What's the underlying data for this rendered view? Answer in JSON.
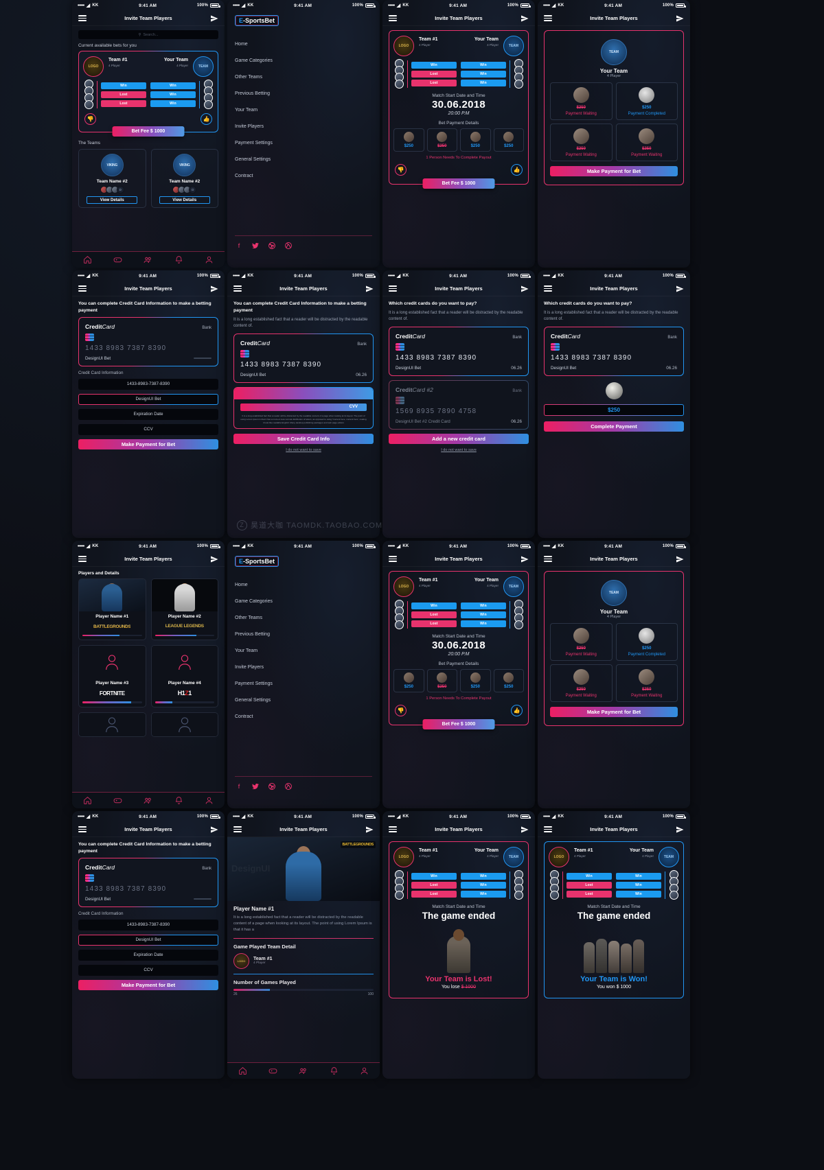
{
  "status_bar": {
    "carrier": "KK",
    "dots": "•••••",
    "time": "9:41 AM",
    "battery": "100%"
  },
  "nav": {
    "title": "Invite Team Players"
  },
  "search": {
    "placeholder": "Search...",
    "icon": "search-icon"
  },
  "brand": {
    "logo_prefix": "E",
    "logo_rest": "-SportsBet"
  },
  "drawer": {
    "items": [
      "Home",
      "Game Categories",
      "Other Teams",
      "Previous Betting",
      "Your Team",
      "Invite Players",
      "Payment Settings",
      "General Settings",
      "Contract"
    ],
    "social": [
      "facebook-icon",
      "twitter-icon",
      "dribbble-icon",
      "xbox-icon"
    ]
  },
  "tabbar": {
    "items": [
      "home-icon",
      "controller-icon",
      "team-icon",
      "bell-icon",
      "user-icon"
    ]
  },
  "home": {
    "section_bets": "Current available bets for you",
    "section_teams": "The Teams",
    "bet": {
      "left_team": "Team #1",
      "left_sub": "4 Player",
      "right_team": "Your Team",
      "right_sub": "4 Player",
      "scores_left": [
        "Win",
        "Lost",
        "Lost"
      ],
      "scores_right": [
        "Win",
        "Win",
        "Win"
      ],
      "fee_label": "Bet Fee $ 1000",
      "thumb_down": "thumb-down-icon",
      "thumb_up": "thumb-up-icon"
    },
    "teams": [
      {
        "name": "Team Name #2",
        "more": "D",
        "view": "View Details"
      },
      {
        "name": "Team Name #2",
        "more": "D",
        "view": "View Details"
      }
    ]
  },
  "match": {
    "date_label": "Match Start Date and Time",
    "date": "30.06.2018",
    "time": "20:00 P.M",
    "payment_label": "Bet Payment Details",
    "payments": [
      {
        "amount": "$250",
        "paid": true
      },
      {
        "amount": "$250",
        "paid": false
      },
      {
        "amount": "$250",
        "paid": true
      },
      {
        "amount": "$250",
        "paid": true
      }
    ],
    "need_payout": "1 Person Needs To Complete Payout",
    "fee_label": "Bet Fee $ 1000",
    "ended_label": "The game ended"
  },
  "team_payment": {
    "team_name": "Your Team",
    "team_sub": "4 Player",
    "cells": [
      {
        "amount": "$250",
        "status": "Payment Waiting",
        "state": "wait"
      },
      {
        "amount": "$250",
        "status": "Payment Completed",
        "state": "done"
      },
      {
        "amount": "$250",
        "status": "Payment Waiting",
        "state": "wait"
      },
      {
        "amount": "$250",
        "status": "Payment Waiting",
        "state": "wait"
      }
    ],
    "cta": "Make Payment for Bet"
  },
  "credit_card": {
    "heading": "You can complete Credit Card Information to make a betting payment",
    "subtext": "It is a long established fact that a reader will be distracted by the readable content of.",
    "card": {
      "brand_bold": "Credit",
      "brand_italic": "Card",
      "bank": "Bank",
      "number": "1433  8983  7387  8390",
      "holder": "DesignUI Bet",
      "expiry": "06.26"
    },
    "card2": {
      "brand_bold": "Credit",
      "brand_italic": "Card #2",
      "bank": "Bank",
      "number": "1569  8935  7890  4758",
      "holder": "DesignUI Bet #2 Credit Card",
      "expiry": "06.26"
    },
    "info_label": "Credit Card Information",
    "fields": {
      "number": "1433-8983-7387-8390",
      "name": "DesignUI Bet",
      "expiry": "Expiration Date",
      "ccv": "CCV"
    },
    "cvv_label": "CVV",
    "fine_print": "It is a long established fact that a reader will be distracted by the readable content of a page when looking at its layout. The point of using Lorem Ipsum is that it has a more-or-less normal distribution of letters, as opposed to using 'Content here, content here', making it look like readable English. Many desktop publishing packages and web page editors",
    "cta_pay": "Make Payment for Bet",
    "cta_save": "Save Credit Card Info",
    "cta_add": "Add a new credit card",
    "cta_complete": "Complete Payment",
    "do_not_save": "I do not want to save",
    "question": "Which credit cards do you want to pay?",
    "amount": "$250"
  },
  "players": {
    "section": "Players and Details",
    "list": [
      {
        "name": "Player Name #1",
        "game": "BATTLEGROUNDS",
        "game_key": "pubg",
        "progress": 62
      },
      {
        "name": "Player Name #2",
        "game": "LEAGUE LEGENDS",
        "game_key": "lol",
        "progress": 70
      },
      {
        "name": "Player Name #3",
        "game": "FORTNITE",
        "game_key": "fortnite",
        "progress": 82
      },
      {
        "name": "Player Name #4",
        "game": "H1Z1",
        "game_key": "h1z1",
        "progress": 30
      },
      {
        "name": "",
        "game": "",
        "game_key": "empty",
        "progress": 0
      },
      {
        "name": "",
        "game": "",
        "game_key": "empty",
        "progress": 0
      }
    ]
  },
  "player_detail": {
    "badge": "BATTLEGROUNDS",
    "name": "Player Name #1",
    "desc": "It is a long established fact that a reader will be distracted by the readable content of a page when looking at its layout. The point of using Lorem Ipsum is that it has a",
    "team_detail_heading": "Game Played Team Detail",
    "team_name": "Team #1",
    "team_sub": "4 Player",
    "games_heading": "Number of Games Played",
    "games_played": "26",
    "games_total": "100",
    "games_percent": 26
  },
  "results": {
    "lost": {
      "title": "Your Team is Lost!",
      "sub_prefix": "You lose ",
      "sub_amount": "$ 1000"
    },
    "won": {
      "title": "Your Team is Won!",
      "sub_prefix": "You won ",
      "sub_amount": "$ 1000"
    }
  },
  "watermark": {
    "text": "昊道大咖   TAOMDK.TAOBAO.COM",
    "mark": "Z"
  },
  "colors": {
    "pink": "#e8336d",
    "blue": "#2196f3",
    "bg": "#10141d"
  }
}
